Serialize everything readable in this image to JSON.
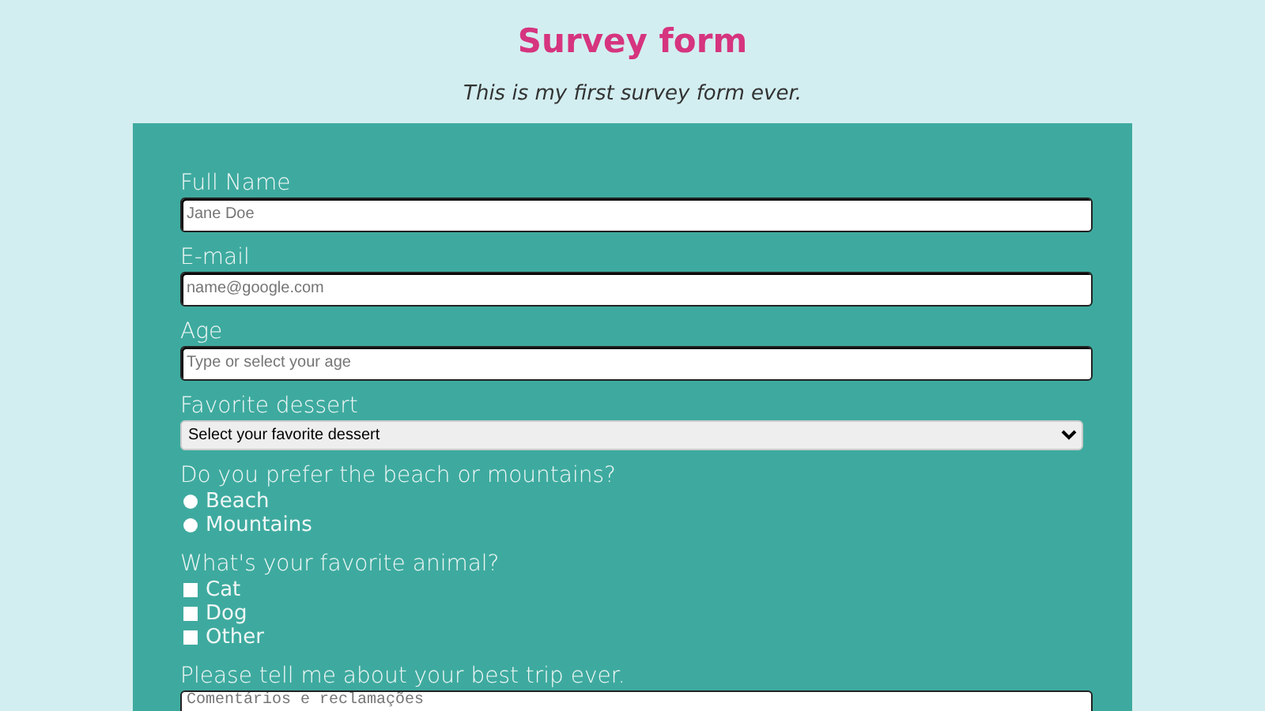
{
  "title": "Survey form",
  "subtitle": "This is my first survey form ever.",
  "fields": [
    {
      "kind": "text",
      "label": "Full Name",
      "placeholder": "Jane Doe"
    },
    {
      "kind": "text",
      "label": "E-mail",
      "placeholder": "name@google.com"
    },
    {
      "kind": "text",
      "label": "Age",
      "placeholder": "Type or select your age"
    },
    {
      "kind": "select",
      "label": "Favorite dessert",
      "value": "Select your favorite dessert"
    },
    {
      "kind": "radio",
      "label": "Do you prefer the beach or mountains?",
      "options": [
        {
          "label": "Beach",
          "selected": false
        },
        {
          "label": "Mountains",
          "selected": false
        }
      ]
    },
    {
      "kind": "checkbox",
      "label": "What's your favorite animal?",
      "options": [
        {
          "label": "Cat",
          "checked": false
        },
        {
          "label": "Dog",
          "checked": false
        },
        {
          "label": "Other",
          "checked": false
        }
      ]
    },
    {
      "kind": "textarea",
      "label": "Please tell me about your best trip ever.",
      "placeholder": "Comentários e reclamações"
    }
  ]
}
